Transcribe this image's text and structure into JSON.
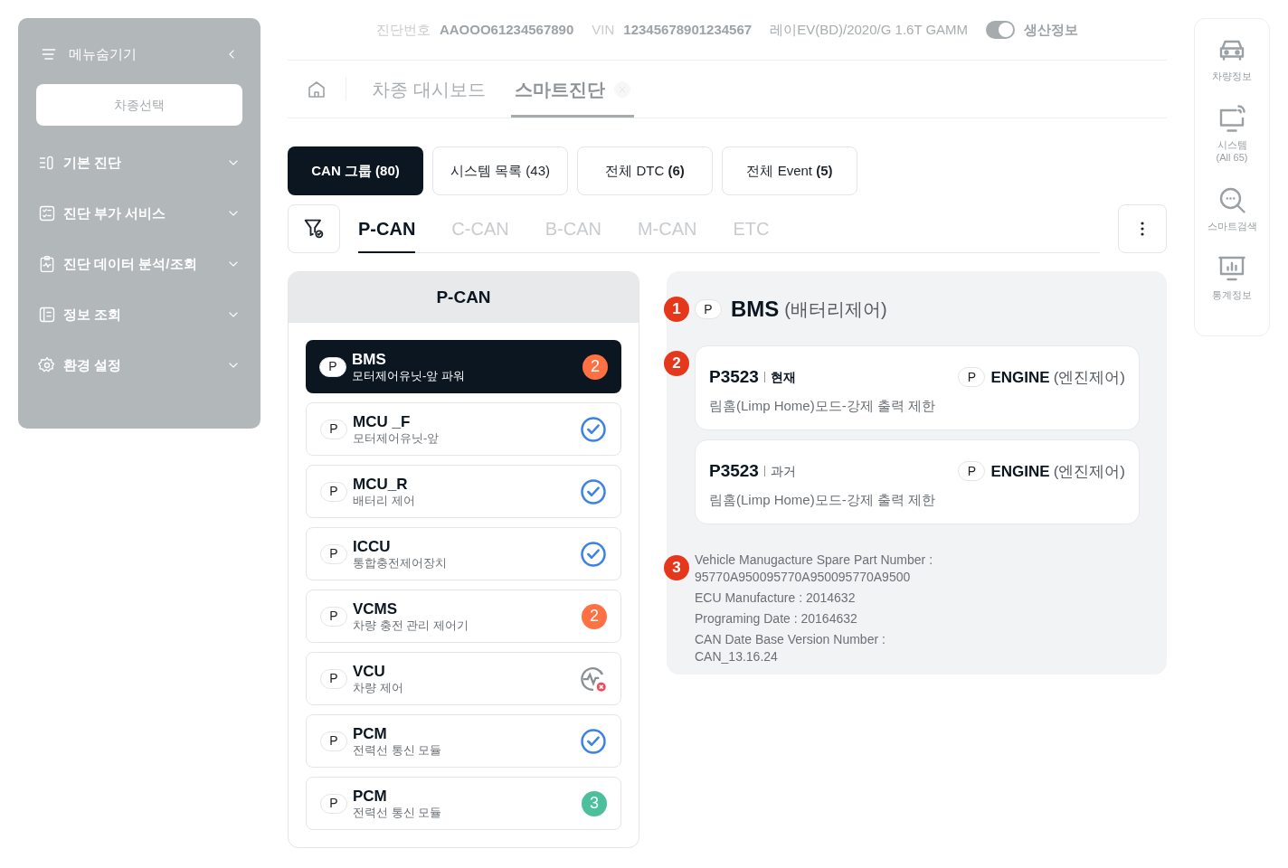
{
  "sidebar": {
    "menu_toggle": "메뉴숨기기",
    "select_button": "차종선택",
    "items": [
      {
        "label": "기본 진단",
        "expanded": false
      },
      {
        "label": "진단 부가 서비스",
        "expanded": false
      },
      {
        "label": "진단 데이터 분석/조회",
        "expanded": false
      },
      {
        "label": "정보 조회",
        "expanded": false
      },
      {
        "label": "환경 설정",
        "expanded": false
      }
    ]
  },
  "header": {
    "diag_label": "진단번호",
    "diag_no": "AAOOO61234567890",
    "vin_label": "VIN",
    "vin": "12345678901234567",
    "model": "레이EV(BD)/2020/G 1.6T GAMM",
    "toggle": {
      "label": "생산정보",
      "on": true
    }
  },
  "breadcrumb": [
    {
      "label": "차종 대시보드",
      "selected": false,
      "closable": false
    },
    {
      "label": "스마트진단",
      "selected": true,
      "closable": true
    }
  ],
  "group_tabs": [
    {
      "label": "CAN 그룹 (80)",
      "selected": true
    },
    {
      "label": "시스템 목록 (43)",
      "selected": false
    },
    {
      "label": "전체 DTC  **(6)**",
      "selected": false
    },
    {
      "label": "전체 Event  **(5)**",
      "selected": false
    }
  ],
  "can_tabs": [
    {
      "label": "P-CAN",
      "selected": true
    },
    {
      "label": "C-CAN",
      "selected": false
    },
    {
      "label": "B-CAN",
      "selected": false
    },
    {
      "label": "M-CAN",
      "selected": false
    },
    {
      "label": "ETC",
      "selected": false
    }
  ],
  "system_list": {
    "title": "P-CAN",
    "items": [
      {
        "badge": "P",
        "name": "BMS",
        "desc": "모터제어유닛-앞 파워",
        "selected": true,
        "status": {
          "kind": "count",
          "count": "2",
          "color": "#ff7043"
        }
      },
      {
        "badge": "P",
        "name": "MCU _F",
        "desc": "모터제어유닛-앞",
        "selected": false,
        "status": {
          "kind": "ok"
        }
      },
      {
        "badge": "P",
        "name": "MCU_R",
        "desc": "배터리 제어",
        "selected": false,
        "status": {
          "kind": "ok"
        }
      },
      {
        "badge": "P",
        "name": "ICCU",
        "desc": "통합충전제어장치",
        "selected": false,
        "status": {
          "kind": "ok"
        }
      },
      {
        "badge": "P",
        "name": "VCMS",
        "desc": "차량 충전 관리 제어기",
        "selected": false,
        "status": {
          "kind": "count",
          "count": "2",
          "color": "#ff7043"
        }
      },
      {
        "badge": "P",
        "name": "VCU",
        "desc": "차량 제어",
        "selected": false,
        "status": {
          "kind": "error"
        }
      },
      {
        "badge": "P",
        "name": "PCM",
        "desc": "전력선 통신 모듈",
        "selected": false,
        "status": {
          "kind": "ok"
        }
      },
      {
        "badge": "P",
        "name": "PCM",
        "desc": "전력선 통신 모듈",
        "selected": false,
        "status": {
          "kind": "count",
          "count": "3",
          "color": "#4cbf9b"
        }
      }
    ]
  },
  "detail": {
    "marker_1": "1",
    "badge": "P",
    "name": "BMS",
    "sub": "(배터리제어)",
    "marker_2": "2",
    "dtcs": [
      {
        "code": "P3523",
        "state": "현재",
        "current": true,
        "badge": "P",
        "system": "ENGINE",
        "system_sub": "(엔진제어)",
        "desc": "림홈(Limp Home)모드-강제 출력 제한"
      },
      {
        "code": "P3523",
        "state": "과거",
        "current": false,
        "badge": "P",
        "system": "ENGINE",
        "system_sub": "(엔진제어)",
        "desc": "림홈(Limp Home)모드-강제 출력 제한"
      }
    ],
    "marker_3": "3",
    "info": [
      "Vehicle Manugacture Spare Part Number : 95770A950095770A950095770A9500",
      "ECU Manufacture : 2014632",
      "Programing Date : 20164632",
      "CAN Date Base Version Number : CAN_13.16.24"
    ]
  },
  "rail": [
    {
      "lines": [
        "차량정보"
      ]
    },
    {
      "lines": [
        "시스템",
        "(All 65)"
      ]
    },
    {
      "lines": [
        "스마트검색"
      ]
    },
    {
      "lines": [
        "통계정보"
      ]
    }
  ]
}
